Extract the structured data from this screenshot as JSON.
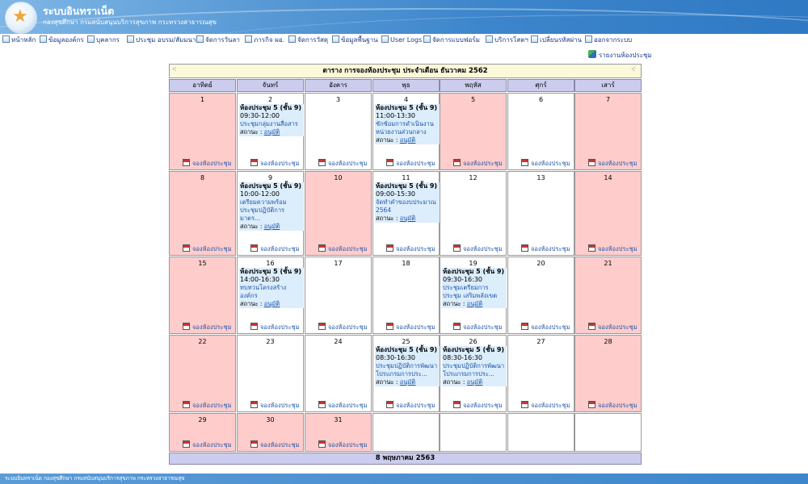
{
  "header": {
    "title": "ระบบอินทราเน็ต",
    "subtitle": "กองสุขศึกษา กรมสนับสนุนบริการสุขภาพ กระทรวงสาธารณสุข"
  },
  "menu": [
    {
      "label": "หน้าหลัก",
      "icon": "home-icon"
    },
    {
      "label": "ข้อมูลองค์กร",
      "icon": "folder-icon"
    },
    {
      "label": "บุคลากร",
      "icon": "people-icon"
    },
    {
      "label": "ประชุม อบรม/สัมมนา",
      "icon": "table-icon"
    },
    {
      "label": "จัดการวันลา",
      "icon": "edit-icon"
    },
    {
      "label": "ภารกิจ ผอ.",
      "icon": "table-icon"
    },
    {
      "label": "จัดการวัสดุ",
      "icon": "table-icon"
    },
    {
      "label": "ข้อมูลพื้นฐาน",
      "icon": "database-icon"
    },
    {
      "label": "User Logs",
      "icon": "log-icon"
    },
    {
      "label": "จัดการแบบฟอร์ม",
      "icon": "form-icon"
    },
    {
      "label": "บริการโสตฯ",
      "icon": "table-icon"
    },
    {
      "label": "เปลี่ยนรหัสผ่าน",
      "icon": "key-icon"
    },
    {
      "label": "ออกจากระบบ",
      "icon": "logout-icon"
    }
  ],
  "report_link": "รายงานห้องประชุม",
  "calendar": {
    "title": "ตาราง การจองห้องประชุม ประจำเดือน ธันวาคม 2562",
    "weekdays": [
      "อาทิตย์",
      "จันทร์",
      "อังคาร",
      "พุธ",
      "พฤหัส",
      "ศุกร์",
      "เสาร์"
    ],
    "book_label": "จองห้องประชุม",
    "status_label": "สถานะ :",
    "status_value": "อนุมัติ",
    "footer_date": "8 พฤษภาคม 2563",
    "weeks": [
      [
        {
          "day": "1",
          "holiday": true
        },
        {
          "day": "2",
          "holiday": false,
          "event": {
            "room": "ห้องประชุม 5 (ชั้น 9)",
            "time": "09:30-12:00",
            "desc": "ประชุมกลุ่มงานสื่อสาร"
          }
        },
        {
          "day": "3",
          "holiday": false
        },
        {
          "day": "4",
          "holiday": false,
          "event": {
            "room": "ห้องประชุม 5 (ชั้น 9)",
            "time": "11:00-13:30",
            "desc": "ซักซ้อมการดำเนินงาน หน่วยงานส่วนกลาง"
          }
        },
        {
          "day": "5",
          "holiday": true
        },
        {
          "day": "6",
          "holiday": false
        },
        {
          "day": "7",
          "holiday": true
        }
      ],
      [
        {
          "day": "8",
          "holiday": true
        },
        {
          "day": "9",
          "holiday": false,
          "event": {
            "room": "ห้องประชุม 5 (ชั้น 9)",
            "time": "10:00-12:00",
            "desc": "เตรียมความพร้อม ประชุมปฏิบัติการ มาตร..."
          }
        },
        {
          "day": "10",
          "holiday": true
        },
        {
          "day": "11",
          "holiday": false,
          "event": {
            "room": "ห้องประชุม 5 (ชั้น 9)",
            "time": "09:00-15:30",
            "desc": "จัดทำคำของบประมาณ 2564"
          }
        },
        {
          "day": "12",
          "holiday": false
        },
        {
          "day": "13",
          "holiday": false
        },
        {
          "day": "14",
          "holiday": true
        }
      ],
      [
        {
          "day": "15",
          "holiday": true
        },
        {
          "day": "16",
          "holiday": false,
          "event": {
            "room": "ห้องประชุม 5 (ชั้น 9)",
            "time": "14:00-16:30",
            "desc": "ทบทวนโครงสร้าง องค์กร"
          }
        },
        {
          "day": "17",
          "holiday": false
        },
        {
          "day": "18",
          "holiday": false
        },
        {
          "day": "19",
          "holiday": false,
          "event": {
            "room": "ห้องประชุม 5 (ชั้น 9)",
            "time": "09:30-16:30",
            "desc": "ประชุมเตรียมการประชุม เสริมพลังเขต"
          }
        },
        {
          "day": "20",
          "holiday": false
        },
        {
          "day": "21",
          "holiday": true
        }
      ],
      [
        {
          "day": "22",
          "holiday": true
        },
        {
          "day": "23",
          "holiday": false
        },
        {
          "day": "24",
          "holiday": false
        },
        {
          "day": "25",
          "holiday": false,
          "event": {
            "room": "ห้องประชุม 5 (ชั้น 9)",
            "time": "08:30-16:30",
            "desc": "ประชุมปฏิบัติการพัฒนา โปรแกรมการประ..."
          }
        },
        {
          "day": "26",
          "holiday": false,
          "event": {
            "room": "ห้องประชุม 5 (ชั้น 9)",
            "time": "08:30-16:30",
            "desc": "ประชุมปฏิบัติการพัฒนา โปรแกรมการประ..."
          }
        },
        {
          "day": "27",
          "holiday": false
        },
        {
          "day": "28",
          "holiday": true
        }
      ],
      [
        {
          "day": "29",
          "holiday": true
        },
        {
          "day": "30",
          "holiday": true
        },
        {
          "day": "31",
          "holiday": true
        },
        {
          "day": "",
          "empty": true
        },
        {
          "day": "",
          "empty": true
        },
        {
          "day": "",
          "empty": true
        },
        {
          "day": "",
          "empty": true
        }
      ]
    ]
  },
  "footer": "ระบบอินทราเน็ต กองสุขศึกษา กรมสนับสนุนบริการสุขภาพ กระทรวงสาธารณสุข"
}
